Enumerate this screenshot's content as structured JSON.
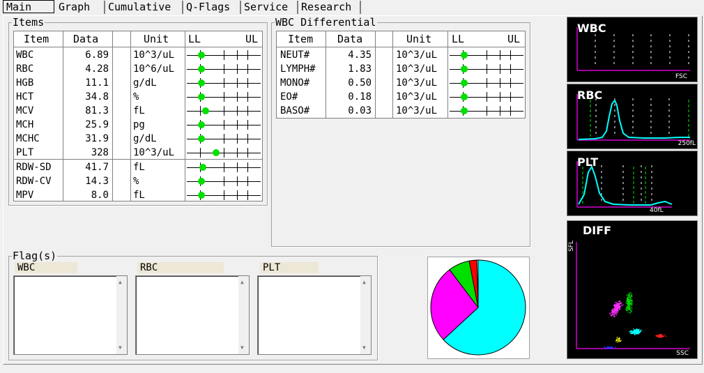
{
  "tabs": [
    "Main",
    "Graph",
    "Cumulative",
    "Q-Flags",
    "Service",
    "Research"
  ],
  "items_group": {
    "title": "Items",
    "headers": {
      "item": "Item",
      "data": "Data",
      "unit": "Unit",
      "ll": "LL",
      "ul": "UL"
    },
    "rows": [
      {
        "item": "WBC",
        "data": "6.89",
        "unit": "10^3/uL",
        "level": 0.2
      },
      {
        "item": "RBC",
        "data": "4.28",
        "unit": "10^6/uL",
        "level": 0.2
      },
      {
        "item": "HGB",
        "data": "11.1",
        "unit": "g/dL",
        "level": 0.2
      },
      {
        "item": "HCT",
        "data": "34.8",
        "unit": "%",
        "level": 0.2
      },
      {
        "item": "MCV",
        "data": "81.3",
        "unit": "fL",
        "level": 0.25
      },
      {
        "item": "MCH",
        "data": "25.9",
        "unit": "pg",
        "level": 0.2
      },
      {
        "item": "MCHC",
        "data": "31.9",
        "unit": "g/dL",
        "level": 0.2
      },
      {
        "item": "PLT",
        "data": "328",
        "unit": "10^3/uL",
        "level": 0.4
      },
      {
        "item": "RDW-SD",
        "data": "41.7",
        "unit": "fL",
        "level": 0.22
      },
      {
        "item": "RDW-CV",
        "data": "14.3",
        "unit": "%",
        "level": 0.2
      },
      {
        "item": "MPV",
        "data": "8.0",
        "unit": "fL",
        "level": 0.2
      }
    ]
  },
  "wbc_diff_group": {
    "title": "WBC Differential",
    "headers": {
      "item": "Item",
      "data": "Data",
      "unit": "Unit",
      "ll": "LL",
      "ul": "UL"
    },
    "rows": [
      {
        "item": "NEUT#",
        "data": "4.35",
        "unit": "10^3/uL",
        "level": 0.2
      },
      {
        "item": "LYMPH#",
        "data": "1.83",
        "unit": "10^3/uL",
        "level": 0.2
      },
      {
        "item": "MONO#",
        "data": "0.50",
        "unit": "10^3/uL",
        "level": 0.2
      },
      {
        "item": "EO#",
        "data": "0.18",
        "unit": "10^3/uL",
        "level": 0.2
      },
      {
        "item": "BASO#",
        "data": "0.03",
        "unit": "10^3/uL",
        "level": 0.2
      }
    ]
  },
  "flags_group": {
    "title": "Flag(s)",
    "boxes": [
      {
        "label": "WBC"
      },
      {
        "label": "RBC"
      },
      {
        "label": "PLT"
      }
    ]
  },
  "pie_chart": {
    "slices": [
      {
        "name": "NEUT",
        "value": 4.35,
        "color": "#00ffff"
      },
      {
        "name": "LYMPH",
        "value": 1.83,
        "color": "#ff00ff"
      },
      {
        "name": "MONO",
        "value": 0.5,
        "color": "#00e000"
      },
      {
        "name": "EO",
        "value": 0.18,
        "color": "#ff0000"
      },
      {
        "name": "BASO",
        "value": 0.03,
        "color": "#ffffff"
      }
    ]
  },
  "scattergrams": {
    "wbc": {
      "title": "WBC",
      "axis_label": "FSC"
    },
    "rbc": {
      "title": "RBC",
      "axis_label": "250fL"
    },
    "plt": {
      "title": "PLT",
      "axis_label": "40fL"
    },
    "diff": {
      "title": "DIFF",
      "x_label": "SSC",
      "y_label": "SFL"
    }
  },
  "colors": {
    "dot": "#00e000",
    "curve": "#00ffff",
    "axis": "#a000a0",
    "marker": "#00c000"
  }
}
